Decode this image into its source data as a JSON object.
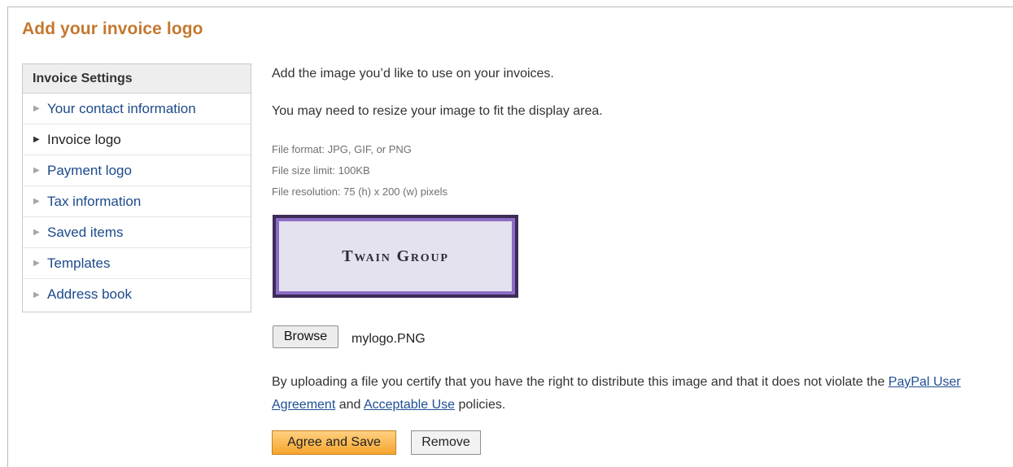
{
  "page": {
    "title": "Add your invoice logo"
  },
  "sidebar": {
    "header": "Invoice Settings",
    "items": [
      {
        "label": "Your contact information",
        "active": false
      },
      {
        "label": "Invoice logo",
        "active": true
      },
      {
        "label": "Payment logo",
        "active": false
      },
      {
        "label": "Tax information",
        "active": false
      },
      {
        "label": "Saved items",
        "active": false
      },
      {
        "label": "Templates",
        "active": false
      },
      {
        "label": "Address book",
        "active": false
      }
    ]
  },
  "main": {
    "intro_line1": "Add the image you’d like to use on your invoices.",
    "intro_line2": "You may need to resize your image to fit the display area.",
    "spec_format": "File format: JPG, GIF, or PNG",
    "spec_size": "File size limit: 100KB",
    "spec_resolution": "File resolution: 75 (h) x 200 (w) pixels",
    "logo_preview_text": "Twain Group",
    "browse_label": "Browse",
    "file_name": "mylogo.PNG",
    "agreement_text_before": "By uploading a file you certify that you have the right to distribute this image and that it does not violate the ",
    "agreement_link1": "PayPal User Agreement",
    "agreement_text_mid": " and ",
    "agreement_link2": "Acceptable Use",
    "agreement_text_after": " policies.",
    "agree_save_label": "Agree and Save",
    "remove_label": "Remove"
  },
  "colors": {
    "title": "#c4782e",
    "link": "#1f4e95",
    "primary_button": "#f6a52e",
    "logo_border": "#3c2c56"
  }
}
